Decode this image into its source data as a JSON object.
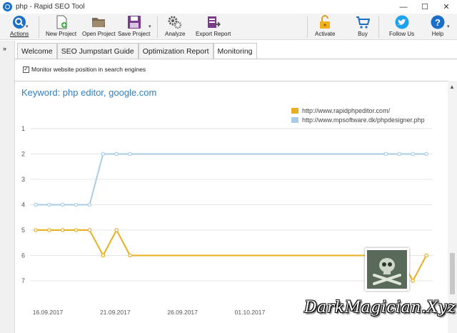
{
  "window": {
    "title": "php - Rapid SEO Tool",
    "controls": {
      "minimize": "—",
      "maximize": "☐",
      "close": "✕"
    }
  },
  "toolbar": {
    "actions": "Actions",
    "new_project": "New Project",
    "open_project": "Open Project",
    "save_project": "Save Project",
    "analyze": "Analyze",
    "export_report": "Export Report",
    "activate": "Activate",
    "buy": "Buy",
    "follow_us": "Follow Us",
    "help": "Help"
  },
  "tabs": [
    {
      "label": "Welcome",
      "active": false
    },
    {
      "label": "SEO Jumpstart Guide",
      "active": false
    },
    {
      "label": "Optimization Report",
      "active": false
    },
    {
      "label": "Monitoring",
      "active": true
    }
  ],
  "monitor": {
    "label": "Monitor website position in search engines",
    "checked": true
  },
  "chart_data": {
    "type": "line",
    "title": "Keyword: php editor, google.com",
    "y_reversed": true,
    "ylim": [
      0.5,
      7.5
    ],
    "yticks": [
      "1",
      "2",
      "3",
      "4",
      "5",
      "6",
      "7"
    ],
    "xticks": [
      "16.09.2017",
      "21.09.2017",
      "26.09.2017",
      "01.10.2017"
    ],
    "legend_position": "top-right",
    "series": [
      {
        "name": "http://www.rapidphpeditor.com/",
        "color": "#e8b020",
        "values": [
          5,
          5,
          5,
          5,
          5,
          6,
          5,
          6,
          6,
          6,
          6,
          6,
          6,
          6,
          6,
          6,
          6,
          6,
          6,
          6,
          6,
          6,
          6,
          6,
          6,
          6,
          6,
          6,
          7,
          6
        ],
        "markers": [
          0,
          1,
          2,
          3,
          4,
          5,
          6,
          7,
          26,
          27,
          28,
          29
        ]
      },
      {
        "name": "http://www.mpsoftware.dk/phpdesigner.php",
        "color": "#a9cbe6",
        "values": [
          4,
          4,
          4,
          4,
          4,
          2,
          2,
          2,
          2,
          2,
          2,
          2,
          2,
          2,
          2,
          2,
          2,
          2,
          2,
          2,
          2,
          2,
          2,
          2,
          2,
          2,
          2,
          2,
          2,
          2
        ],
        "markers": [
          0,
          1,
          2,
          3,
          4,
          5,
          6,
          7,
          26,
          27,
          28,
          29
        ]
      }
    ]
  },
  "watermark": "DarkMagician.Xyz"
}
